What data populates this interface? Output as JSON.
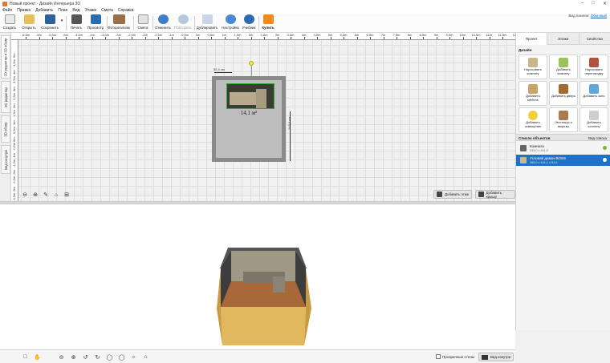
{
  "window": {
    "title": "Новый проект - Дизайн Интерьера 3D"
  },
  "menu": [
    "Файл",
    "Правка",
    "Добавить",
    "План",
    "Вид",
    "Этажи",
    "Смета",
    "Справка"
  ],
  "toolbar": {
    "buttons": [
      {
        "label": "Создать",
        "icon": "new-file-icon"
      },
      {
        "label": "Открыть",
        "icon": "folder-icon"
      },
      {
        "label": "Сохранить",
        "icon": "save-icon"
      },
      {
        "label": "Печать",
        "icon": "printer-icon"
      },
      {
        "label": "Просмотр",
        "icon": "monitor-icon"
      },
      {
        "label": "Фотореализм",
        "icon": "photo-icon"
      },
      {
        "label": "Смета",
        "icon": "estimate-icon"
      },
      {
        "label": "Отменить",
        "icon": "undo-icon"
      },
      {
        "label": "Повторить",
        "icon": "redo-icon"
      },
      {
        "label": "Дублировать",
        "icon": "duplicate-icon"
      },
      {
        "label": "Настройки",
        "icon": "gear-icon"
      },
      {
        "label": "Учебник",
        "icon": "help-icon"
      },
      {
        "label": "Купить",
        "icon": "cart-icon"
      }
    ]
  },
  "user": {
    "label": "Вид панели:",
    "value": "Обычный"
  },
  "side_tabs": [
    "2D редактор и 3D обзор",
    "2D редактор",
    "3D обзор",
    "Вид изнутри"
  ],
  "ruler": {
    "h_labels": [
      "-6,5m",
      "-6m",
      "-5,5m",
      "-5m",
      "-4,5m",
      "-4m",
      "-3,5m",
      "-3m",
      "-2,5m",
      "-2m",
      "-1,5m",
      "-1m",
      "-0,5m",
      "0m",
      "0,5m",
      "1m",
      "1,5m",
      "2m",
      "2,5m",
      "3m",
      "3,5m",
      "4m",
      "4,5m",
      "5m",
      "5,5m",
      "6m",
      "6,5m",
      "7m",
      "7,5m",
      "8m",
      "8,5m",
      "9m",
      "9,5m",
      "10m",
      "10,5m",
      "11m",
      "11,5m",
      "12m"
    ],
    "v_labels": [
      "5m",
      "4,5m",
      "4m",
      "3,5m",
      "3m",
      "2,5m",
      "2m",
      "1,5m",
      "1m",
      "0,5m",
      "0m",
      "-0,5m",
      "-1m",
      "-1,5m",
      "-2m",
      "-2,5m",
      "-3m",
      "-3,5m",
      "-4m"
    ]
  },
  "plan": {
    "room_area": "14,1 м²",
    "dim_top": "52,4 см",
    "dim_right": "243,9 см",
    "add_floor": "Добавить этаж",
    "add_roof": "Добавить крышу"
  },
  "view3d": {
    "transparent_walls": "Прозрачные стены",
    "inside_view": "Вид изнутри"
  },
  "right_panel": {
    "tabs": [
      "Проект",
      "Этажи",
      "Свойства"
    ],
    "design_title": "Дизайн",
    "design_buttons": [
      {
        "label": "Нарисовать комнату",
        "icon": "draw-room-icon",
        "color": "#c9b58c"
      },
      {
        "label": "Добавить комнату",
        "icon": "add-room-icon",
        "color": "#9bc35a"
      },
      {
        "label": "Нарисовать перегородку",
        "icon": "partition-icon",
        "color": "#b0523e"
      },
      {
        "label": "Добавить мебель",
        "icon": "furniture-icon",
        "color": "#c8a468"
      },
      {
        "label": "Добавить дверь",
        "icon": "door-icon",
        "color": "#a46b2e"
      },
      {
        "label": "Добавить окно",
        "icon": "window-icon",
        "color": "#5fa7d8"
      },
      {
        "label": "Добавить освещение",
        "icon": "lamp-icon",
        "color": "#f1d03b"
      },
      {
        "label": "Лестницы и вырезы",
        "icon": "stairs-icon",
        "color": "#a97b4f"
      },
      {
        "label": "Добавить колонну",
        "icon": "column-icon",
        "color": "#cfcfcf"
      }
    ],
    "object_list_title": "Список объектов",
    "list_view_label": "Вид списка",
    "objects": [
      {
        "name": "Комната",
        "dims": "243,0 x 411,0",
        "icon": "room-icon",
        "selected": false
      },
      {
        "name": "Угловой диван BOSS",
        "dims": "285,0 x 161,1 x 91,0",
        "icon": "sofa-icon",
        "selected": true
      }
    ]
  },
  "colors": {
    "accent": "#1e70c8",
    "selection": "#2ea82e",
    "wall": "#8a8a8a"
  }
}
